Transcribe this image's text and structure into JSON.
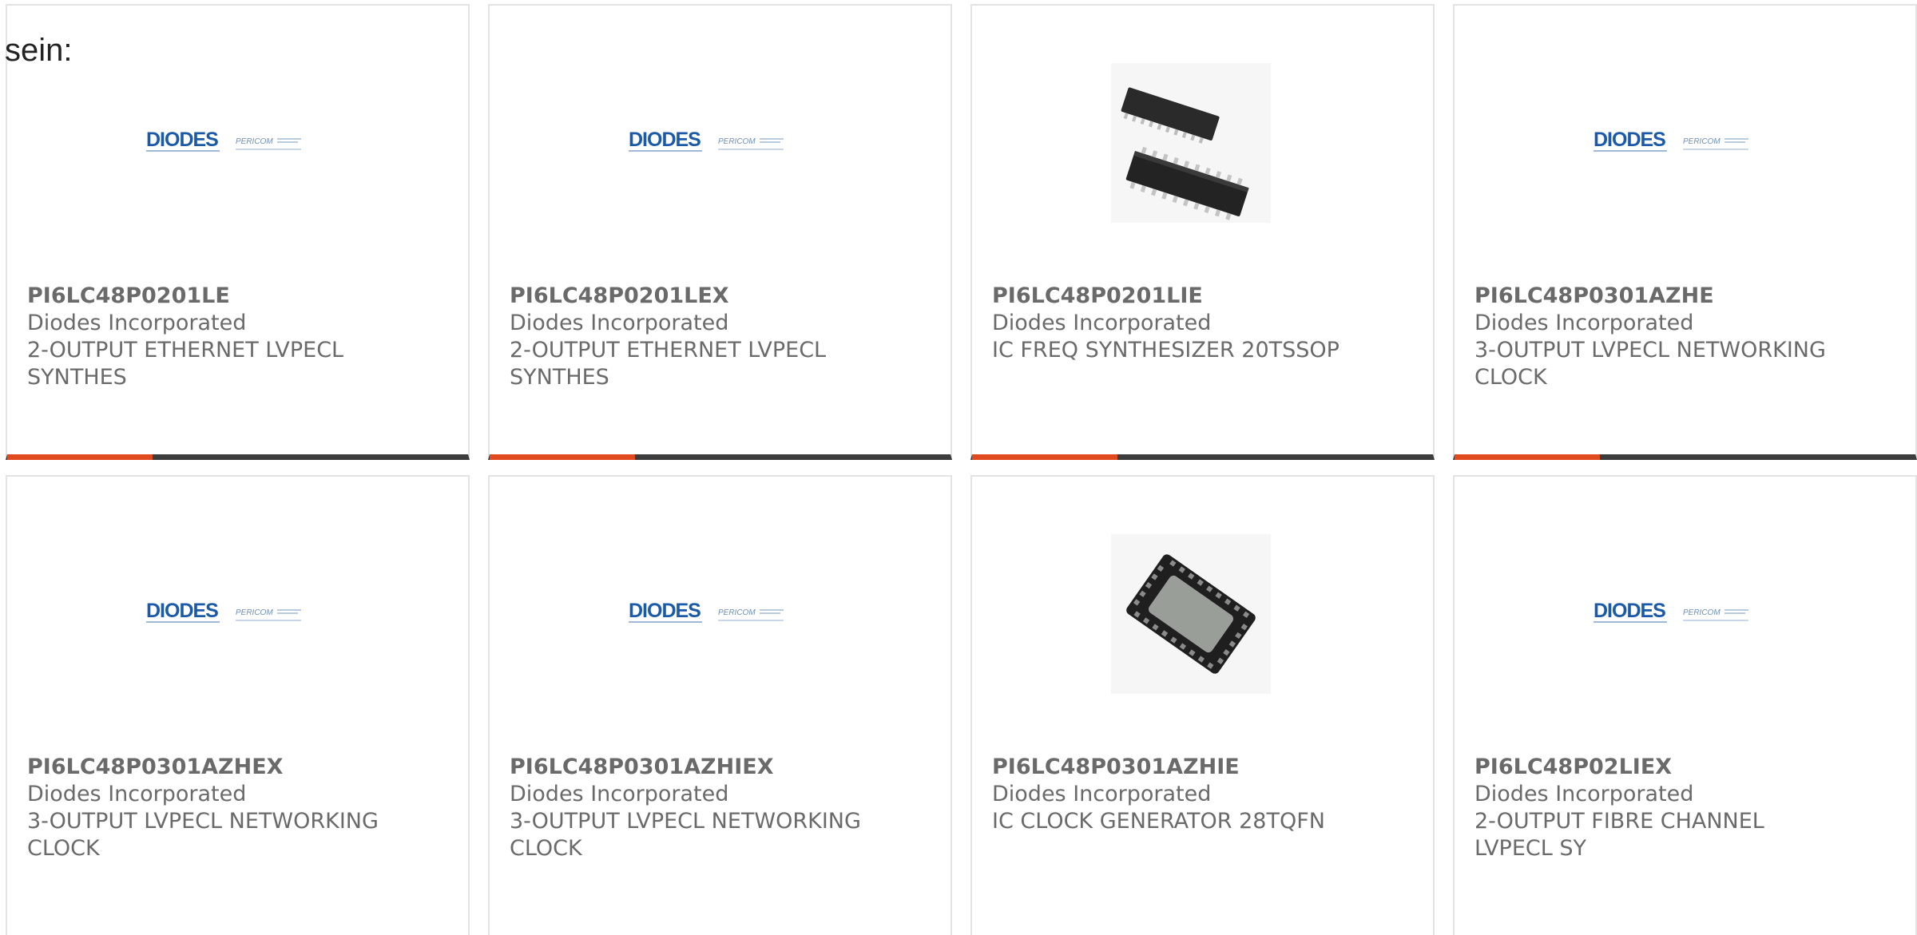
{
  "heading": "sein:",
  "colors": {
    "accent": "#e04a1e",
    "bar": "#3c3c3c",
    "text": "#6a6a6a",
    "brand_blue": "#1b5aa8"
  },
  "brand_logo": {
    "primary": "DIODES",
    "secondary": "PERICOM"
  },
  "products": [
    {
      "part": "PI6LC48P0201LE",
      "manufacturer": "Diodes Incorporated",
      "description": "2-OUTPUT ETHERNET LVPECL SYNTHES",
      "image": "diodes-pericom-logo"
    },
    {
      "part": "PI6LC48P0201LEX",
      "manufacturer": "Diodes Incorporated",
      "description": "2-OUTPUT ETHERNET LVPECL SYNTHES",
      "image": "diodes-pericom-logo"
    },
    {
      "part": "PI6LC48P0201LIE",
      "manufacturer": "Diodes Incorporated",
      "description": "IC FREQ SYNTHESIZER 20TSSOP",
      "image": "tssop-chip-photo"
    },
    {
      "part": "PI6LC48P0301AZHE",
      "manufacturer": "Diodes Incorporated",
      "description": "3-OUTPUT LVPECL NETWORKING CLOCK",
      "image": "diodes-pericom-logo"
    },
    {
      "part": "PI6LC48P0301AZHEX",
      "manufacturer": "Diodes Incorporated",
      "description": "3-OUTPUT LVPECL NETWORKING CLOCK",
      "image": "diodes-pericom-logo"
    },
    {
      "part": "PI6LC48P0301AZHIEX",
      "manufacturer": "Diodes Incorporated",
      "description": "3-OUTPUT LVPECL NETWORKING CLOCK",
      "image": "diodes-pericom-logo"
    },
    {
      "part": "PI6LC48P0301AZHIE",
      "manufacturer": "Diodes Incorporated",
      "description": "IC CLOCK GENERATOR 28TQFN",
      "image": "tqfn-chip-photo"
    },
    {
      "part": "PI6LC48P02LIEX",
      "manufacturer": "Diodes Incorporated",
      "description": "2-OUTPUT FIBRE CHANNEL LVPECL SY",
      "image": "diodes-pericom-logo"
    }
  ]
}
